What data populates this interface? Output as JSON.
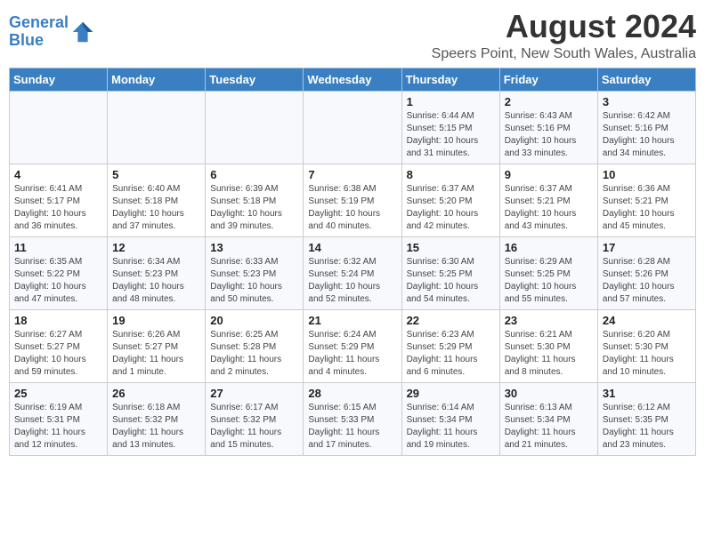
{
  "header": {
    "logo_line1": "General",
    "logo_line2": "Blue",
    "main_title": "August 2024",
    "subtitle": "Speers Point, New South Wales, Australia"
  },
  "weekdays": [
    "Sunday",
    "Monday",
    "Tuesday",
    "Wednesday",
    "Thursday",
    "Friday",
    "Saturday"
  ],
  "weeks": [
    [
      {
        "day": "",
        "empty": true
      },
      {
        "day": "",
        "empty": true
      },
      {
        "day": "",
        "empty": true
      },
      {
        "day": "",
        "empty": true
      },
      {
        "day": "1",
        "sunrise": "6:44 AM",
        "sunset": "5:15 PM",
        "daylight": "10 hours and 31 minutes."
      },
      {
        "day": "2",
        "sunrise": "6:43 AM",
        "sunset": "5:16 PM",
        "daylight": "10 hours and 33 minutes."
      },
      {
        "day": "3",
        "sunrise": "6:42 AM",
        "sunset": "5:16 PM",
        "daylight": "10 hours and 34 minutes."
      }
    ],
    [
      {
        "day": "4",
        "sunrise": "6:41 AM",
        "sunset": "5:17 PM",
        "daylight": "10 hours and 36 minutes."
      },
      {
        "day": "5",
        "sunrise": "6:40 AM",
        "sunset": "5:18 PM",
        "daylight": "10 hours and 37 minutes."
      },
      {
        "day": "6",
        "sunrise": "6:39 AM",
        "sunset": "5:18 PM",
        "daylight": "10 hours and 39 minutes."
      },
      {
        "day": "7",
        "sunrise": "6:38 AM",
        "sunset": "5:19 PM",
        "daylight": "10 hours and 40 minutes."
      },
      {
        "day": "8",
        "sunrise": "6:37 AM",
        "sunset": "5:20 PM",
        "daylight": "10 hours and 42 minutes."
      },
      {
        "day": "9",
        "sunrise": "6:37 AM",
        "sunset": "5:21 PM",
        "daylight": "10 hours and 43 minutes."
      },
      {
        "day": "10",
        "sunrise": "6:36 AM",
        "sunset": "5:21 PM",
        "daylight": "10 hours and 45 minutes."
      }
    ],
    [
      {
        "day": "11",
        "sunrise": "6:35 AM",
        "sunset": "5:22 PM",
        "daylight": "10 hours and 47 minutes."
      },
      {
        "day": "12",
        "sunrise": "6:34 AM",
        "sunset": "5:23 PM",
        "daylight": "10 hours and 48 minutes."
      },
      {
        "day": "13",
        "sunrise": "6:33 AM",
        "sunset": "5:23 PM",
        "daylight": "10 hours and 50 minutes."
      },
      {
        "day": "14",
        "sunrise": "6:32 AM",
        "sunset": "5:24 PM",
        "daylight": "10 hours and 52 minutes."
      },
      {
        "day": "15",
        "sunrise": "6:30 AM",
        "sunset": "5:25 PM",
        "daylight": "10 hours and 54 minutes."
      },
      {
        "day": "16",
        "sunrise": "6:29 AM",
        "sunset": "5:25 PM",
        "daylight": "10 hours and 55 minutes."
      },
      {
        "day": "17",
        "sunrise": "6:28 AM",
        "sunset": "5:26 PM",
        "daylight": "10 hours and 57 minutes."
      }
    ],
    [
      {
        "day": "18",
        "sunrise": "6:27 AM",
        "sunset": "5:27 PM",
        "daylight": "10 hours and 59 minutes."
      },
      {
        "day": "19",
        "sunrise": "6:26 AM",
        "sunset": "5:27 PM",
        "daylight": "11 hours and 1 minute."
      },
      {
        "day": "20",
        "sunrise": "6:25 AM",
        "sunset": "5:28 PM",
        "daylight": "11 hours and 2 minutes."
      },
      {
        "day": "21",
        "sunrise": "6:24 AM",
        "sunset": "5:29 PM",
        "daylight": "11 hours and 4 minutes."
      },
      {
        "day": "22",
        "sunrise": "6:23 AM",
        "sunset": "5:29 PM",
        "daylight": "11 hours and 6 minutes."
      },
      {
        "day": "23",
        "sunrise": "6:21 AM",
        "sunset": "5:30 PM",
        "daylight": "11 hours and 8 minutes."
      },
      {
        "day": "24",
        "sunrise": "6:20 AM",
        "sunset": "5:30 PM",
        "daylight": "11 hours and 10 minutes."
      }
    ],
    [
      {
        "day": "25",
        "sunrise": "6:19 AM",
        "sunset": "5:31 PM",
        "daylight": "11 hours and 12 minutes."
      },
      {
        "day": "26",
        "sunrise": "6:18 AM",
        "sunset": "5:32 PM",
        "daylight": "11 hours and 13 minutes."
      },
      {
        "day": "27",
        "sunrise": "6:17 AM",
        "sunset": "5:32 PM",
        "daylight": "11 hours and 15 minutes."
      },
      {
        "day": "28",
        "sunrise": "6:15 AM",
        "sunset": "5:33 PM",
        "daylight": "11 hours and 17 minutes."
      },
      {
        "day": "29",
        "sunrise": "6:14 AM",
        "sunset": "5:34 PM",
        "daylight": "11 hours and 19 minutes."
      },
      {
        "day": "30",
        "sunrise": "6:13 AM",
        "sunset": "5:34 PM",
        "daylight": "11 hours and 21 minutes."
      },
      {
        "day": "31",
        "sunrise": "6:12 AM",
        "sunset": "5:35 PM",
        "daylight": "11 hours and 23 minutes."
      }
    ]
  ]
}
